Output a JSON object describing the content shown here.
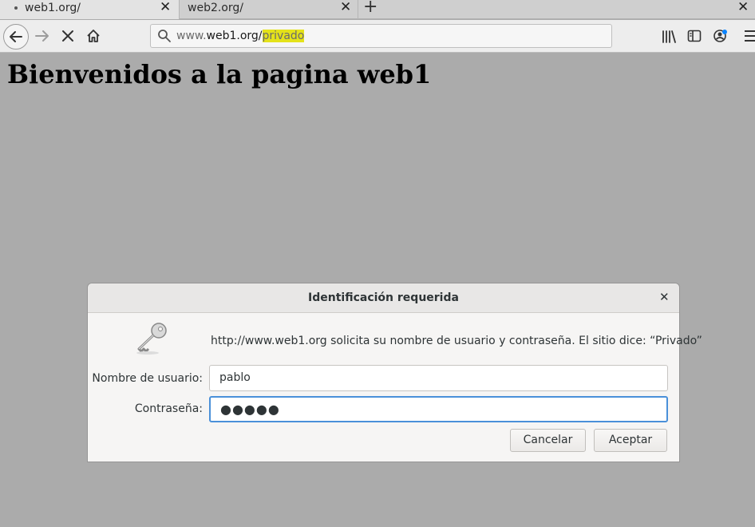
{
  "tabs": [
    {
      "label": "web1.org/",
      "active": true
    },
    {
      "label": "web2.org/",
      "active": false
    }
  ],
  "newtab_label": "+",
  "tab_close_glyph": "✕",
  "url": {
    "prefix": "www.",
    "host": "web1.org/",
    "path": "privado"
  },
  "page": {
    "heading": "Bienvenidos a la pagina web1"
  },
  "dialog": {
    "title": "Identificación requerida",
    "close_glyph": "✕",
    "message": "http://www.web1.org solicita su nombre de usuario y contraseña. El sitio dice: “Privado”",
    "username_label": "Nombre de usuario:",
    "username_value": "pablo",
    "password_label": "Contraseña:",
    "password_mask": "●●●●●",
    "cancel_label": "Cancelar",
    "ok_label": "Aceptar"
  },
  "icons": [
    "back-icon",
    "forward-icon",
    "stop-icon",
    "home-icon",
    "search-icon",
    "library-icon",
    "sidebar-icon",
    "account-icon",
    "menu-icon",
    "key-icon"
  ],
  "colors": {
    "highlight": "#e4e21a",
    "focus": "#4a90d9",
    "page_bg": "#ababab"
  }
}
